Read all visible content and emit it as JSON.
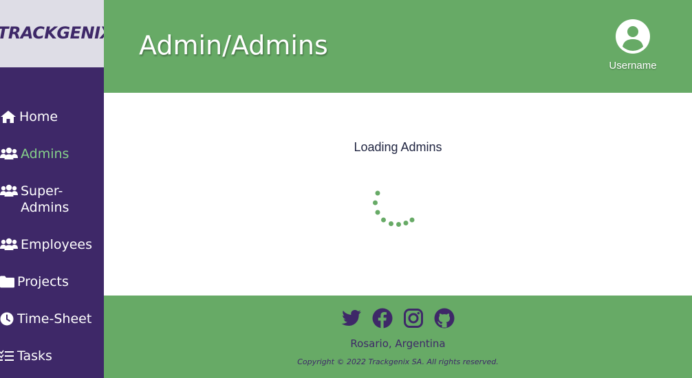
{
  "app": {
    "logo": "TRACKGENIX",
    "page_title": "Admin/Admins"
  },
  "user": {
    "name": "Username",
    "icon": "user-circle-icon"
  },
  "sidebar": {
    "items": [
      {
        "label": "Home",
        "icon": "home-icon",
        "active": false
      },
      {
        "label": "Admins",
        "icon": "users-icon",
        "active": true
      },
      {
        "label": "Super-Admins",
        "icon": "users-icon",
        "active": false
      },
      {
        "label": "Employees",
        "icon": "users-icon",
        "active": false
      },
      {
        "label": "Projects",
        "icon": "folder-icon",
        "active": false
      },
      {
        "label": "Time-Sheet",
        "icon": "clock-icon",
        "active": false
      },
      {
        "label": "Tasks",
        "icon": "tasks-list-icon",
        "active": false
      }
    ]
  },
  "main": {
    "loading_text": "Loading Admins",
    "spinner_icon": "loading-spinner-icon"
  },
  "footer": {
    "social": [
      "twitter-icon",
      "facebook-icon",
      "instagram-icon",
      "github-icon"
    ],
    "location": "Rosario, Argentina",
    "copyright": "Copyright © 2022 Trackgenix SA. All rights reserved."
  },
  "colors": {
    "sidebar_bg": "#3e2868",
    "header_bg": "#67aa66",
    "logo_bg": "#dedde6",
    "active_nav": "#86d28a",
    "spinner": "#67aa66"
  }
}
